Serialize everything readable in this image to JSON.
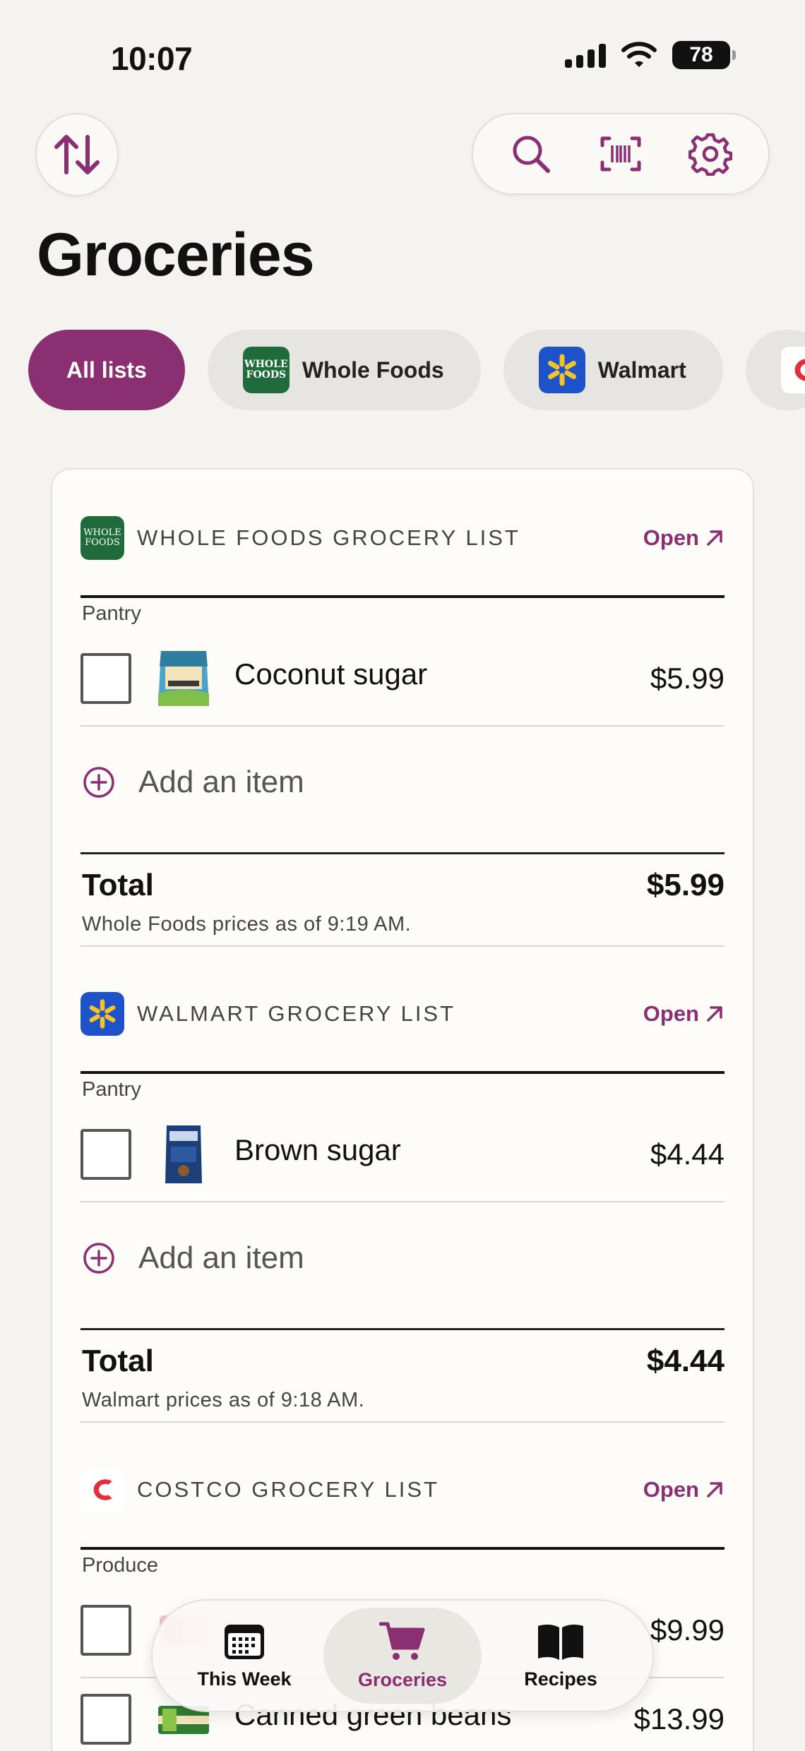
{
  "status_bar": {
    "time": "10:07",
    "battery": "78"
  },
  "header": {
    "title": "Groceries"
  },
  "colors": {
    "accent": "#8a2f72",
    "whole_foods_green": "#1f6b3b",
    "walmart_blue": "#1e52c9",
    "walmart_yellow": "#f5c228",
    "costco_red": "#e0303b"
  },
  "filters": {
    "all": "All lists",
    "whole_foods": "Whole Foods",
    "walmart": "Walmart"
  },
  "logos": {
    "whole_foods_line1": "WHOLE",
    "whole_foods_line2": "FOODS"
  },
  "lists": [
    {
      "title": "WHOLE FOODS GROCERY LIST",
      "open": "Open",
      "category": "Pantry",
      "items": [
        {
          "name": "Coconut sugar",
          "price": "$5.99"
        }
      ],
      "add_item": "Add an item",
      "total_label": "Total",
      "total": "$5.99",
      "as_of": "Whole Foods prices as of 9:19 AM."
    },
    {
      "title": "WALMART GROCERY LIST",
      "open": "Open",
      "category": "Pantry",
      "items": [
        {
          "name": "Brown sugar",
          "price": "$4.44"
        }
      ],
      "add_item": "Add an item",
      "total_label": "Total",
      "total": "$4.44",
      "as_of": "Walmart prices as of 9:18 AM."
    },
    {
      "title": "COSTCO GROCERY LIST",
      "open": "Open",
      "category": "Produce",
      "items": [
        {
          "name": "",
          "price": "$9.99"
        },
        {
          "name": "Canned green beans",
          "price": "$13.99"
        }
      ]
    }
  ],
  "tabbar": {
    "this_week": "This Week",
    "groceries": "Groceries",
    "recipes": "Recipes"
  }
}
